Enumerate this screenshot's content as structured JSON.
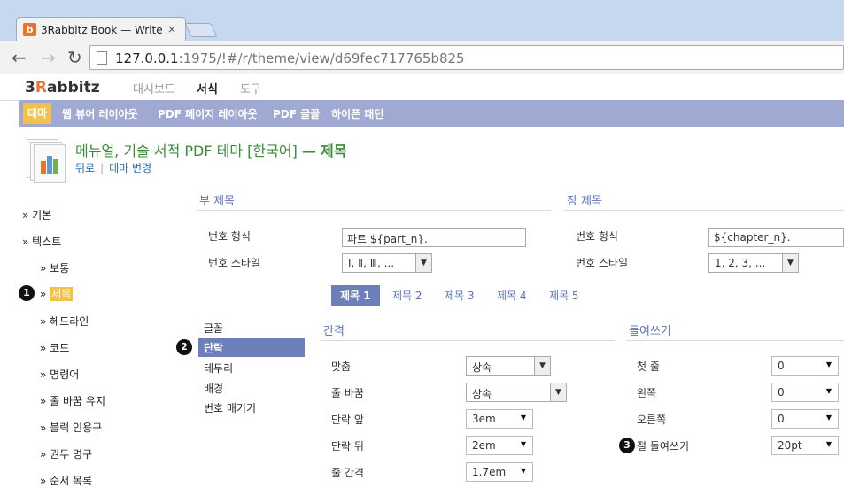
{
  "browser": {
    "tab_title": "3Rabbitz Book — Write d",
    "tab_close": "×",
    "url_host": "127.0.0.1",
    "url_rest": ":1975/!#/r/theme/view/d69fec717765b825"
  },
  "app": {
    "logo_prefix": "3",
    "logo_r": "R",
    "logo_rest": "abbitz",
    "nav": [
      "대시보드",
      "서식",
      "도구"
    ],
    "subnav": [
      "테마",
      "웹 뷰어 레이아웃",
      "PDF 페이지 레이아웃",
      "PDF 글꼴",
      "하이픈 패턴"
    ]
  },
  "header": {
    "title": "메뉴얼, 기술 서적 PDF 테마 [한국어]",
    "dash": "—",
    "subtitle": "제목",
    "back_link": "뒤로",
    "sep": "|",
    "change_link": "테마 변경"
  },
  "sidebar": {
    "items": [
      {
        "label": "» 기본"
      },
      {
        "label": "» 텍스트"
      },
      {
        "label": "» 보통"
      },
      {
        "label": "제목",
        "prefix": "» "
      },
      {
        "label": "» 헤드라인"
      },
      {
        "label": "» 코드"
      },
      {
        "label": "» 명령어"
      },
      {
        "label": "» 줄 바꿈 유지"
      },
      {
        "label": "» 블럭 인용구"
      },
      {
        "label": "» 권두 명구"
      },
      {
        "label": "» 순서 목록"
      }
    ],
    "marker": "1"
  },
  "part": {
    "title": "부 제목",
    "format_label": "번호 형식",
    "format_value": "파트 ${part_n}.",
    "style_label": "번호 스타일",
    "style_value": "Ⅰ, Ⅱ, Ⅲ, ..."
  },
  "chapter": {
    "title": "장 제목",
    "format_label": "번호 형식",
    "format_value": "${chapter_n}.",
    "style_label": "번호 스타일",
    "style_value": "1, 2, 3, ..."
  },
  "heading_tabs": [
    "제목 1",
    "제목 2",
    "제목 3",
    "제목 4",
    "제목 5"
  ],
  "categories": {
    "items": [
      "글꼴",
      "단락",
      "테두리",
      "배경",
      "번호 매기기"
    ],
    "marker": "2"
  },
  "spacing": {
    "title": "간격",
    "rows": [
      {
        "label": "맞춤",
        "value": "상속"
      },
      {
        "label": "줄 바꿈",
        "value": "상속"
      },
      {
        "label": "단락 앞",
        "value": "3em"
      },
      {
        "label": "단락 뒤",
        "value": "2em"
      },
      {
        "label": "줄 간격",
        "value": "1.7em"
      }
    ]
  },
  "indent": {
    "title": "들여쓰기",
    "rows": [
      {
        "label": "첫 줄",
        "value": "0"
      },
      {
        "label": "왼쪽",
        "value": "0"
      },
      {
        "label": "오른쪽",
        "value": "0"
      },
      {
        "label": "절 들여쓰기",
        "value": "20pt"
      }
    ],
    "marker": "3"
  }
}
